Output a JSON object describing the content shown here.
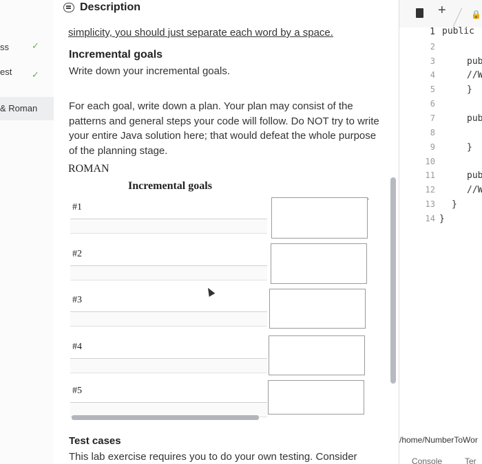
{
  "sidebar": {
    "items": [
      {
        "label": "ss",
        "done": true
      },
      {
        "label": "est",
        "done": true
      },
      {
        "label": "& Roman",
        "done": false
      }
    ],
    "check_glyph": "✓"
  },
  "description": {
    "header_title": "Description",
    "header_icon": "description-icon",
    "partial_line": "simplicity, you should just separate each word by a space.",
    "goals_heading": "Incremental goals",
    "goals_instruction": "Write down your incremental goals.",
    "plan_paragraph": "For each goal, write down a plan. Your plan may consist of the patterns and general steps your code will follow. Do NOT try to write your entire Java solution here; that would defeat the whole purpose of the planning stage.",
    "roman_label": "ROMAN",
    "table_title": "Incremental goals",
    "goals": [
      {
        "number": "#1",
        "value": ""
      },
      {
        "number": "#2",
        "value": ""
      },
      {
        "number": "#3",
        "value": ""
      },
      {
        "number": "#4",
        "value": ""
      },
      {
        "number": "#5",
        "value": ""
      }
    ],
    "test_cases_heading": "Test cases",
    "test_cases_text": "This lab exercise requires you to do your own testing. Consider"
  },
  "editor": {
    "plus_label": "+",
    "tab_glyph": "🔒",
    "line_numbers": [
      "1",
      "2",
      "3",
      "4",
      "5",
      "6",
      "7",
      "8",
      "9",
      "10",
      "11",
      "12",
      "13",
      "14"
    ],
    "code": {
      "line1": "public",
      "line3": "pub",
      "line4": "//W",
      "line5": "}",
      "line7": "pub",
      "line9": "}",
      "line11": "pub",
      "line12": "//W",
      "line13": "}",
      "line14": "}"
    },
    "path": "/home/NumberToWor",
    "bottom_tab_console": "Console",
    "bottom_tab_terminal": "Ter"
  },
  "colors": {
    "check": "#6fae4a",
    "active_sidebar": "#eceef0",
    "scrollbar": "#b7bac0"
  }
}
